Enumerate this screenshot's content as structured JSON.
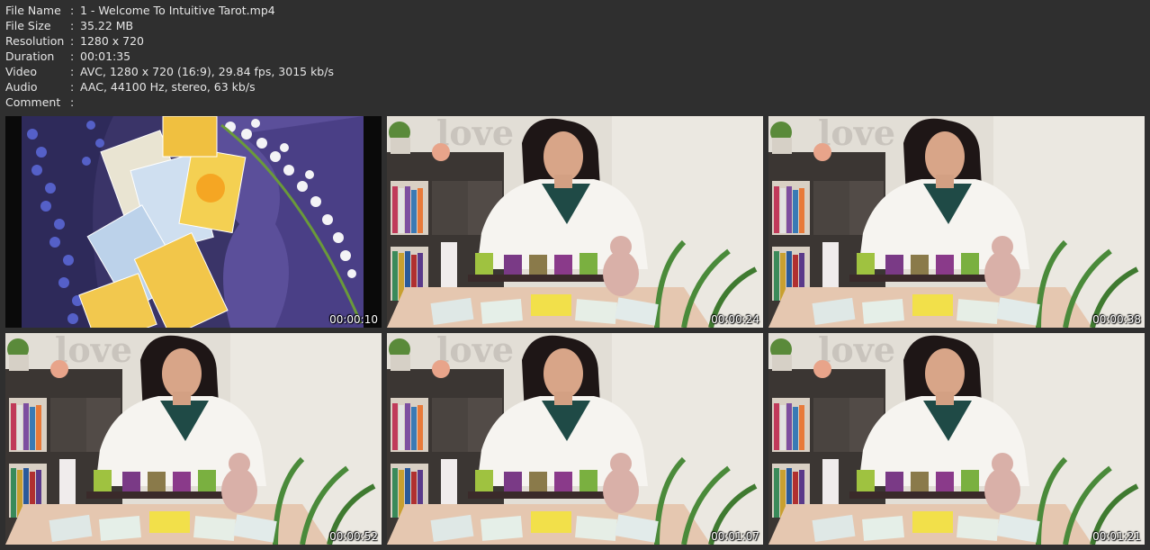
{
  "file_info": [
    {
      "label": "File Name",
      "value": "1 - Welcome To Intuitive Tarot.mp4"
    },
    {
      "label": "File Size",
      "value": "35.22 MB"
    },
    {
      "label": "Resolution",
      "value": "1280 x 720"
    },
    {
      "label": "Duration",
      "value": "00:01:35"
    },
    {
      "label": "Video",
      "value": "AVC, 1280 x 720 (16:9), 29.84 fps, 3015 kb/s"
    },
    {
      "label": "Audio",
      "value": "AAC, 44100 Hz, stereo, 63 kb/s"
    },
    {
      "label": "Comment",
      "value": ""
    }
  ],
  "separator": ":",
  "thumbnails": [
    {
      "timestamp": "00:00:10",
      "scene": "tarot-cards"
    },
    {
      "timestamp": "00:00:24",
      "scene": "presenter"
    },
    {
      "timestamp": "00:00:38",
      "scene": "presenter"
    },
    {
      "timestamp": "00:00:52",
      "scene": "presenter"
    },
    {
      "timestamp": "00:01:07",
      "scene": "presenter"
    },
    {
      "timestamp": "00:01:21",
      "scene": "presenter"
    }
  ]
}
